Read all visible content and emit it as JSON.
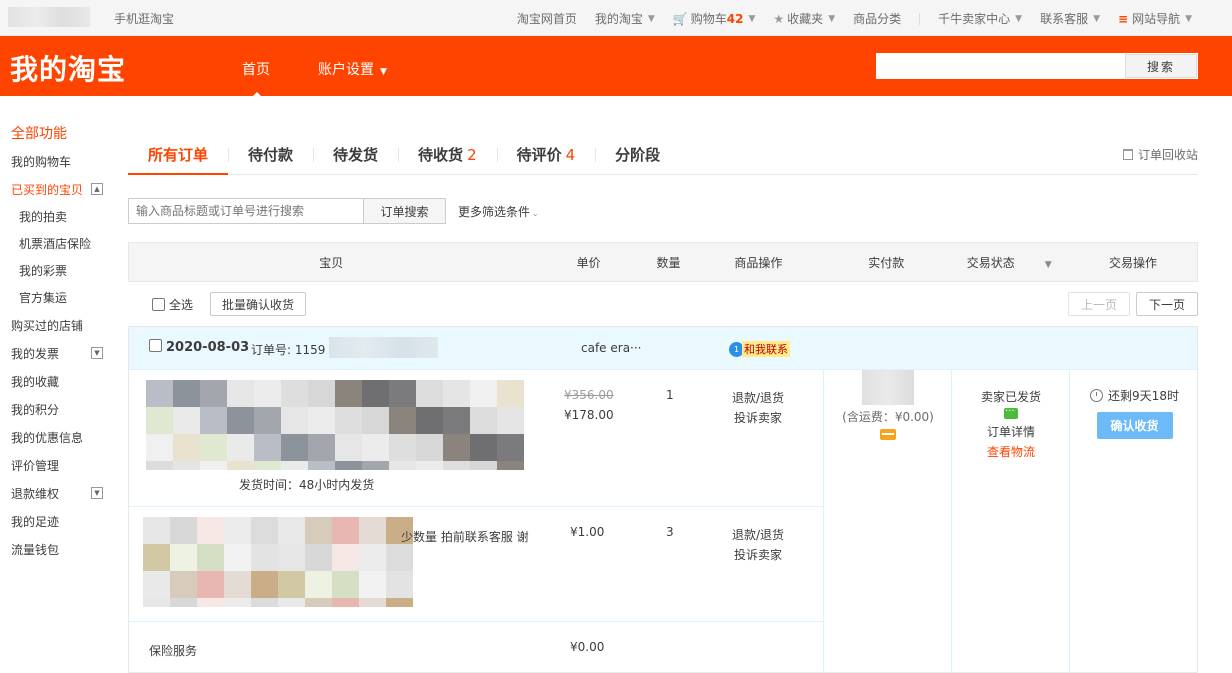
{
  "topbar": {
    "mobile": "手机逛淘宝",
    "links": [
      {
        "label": "淘宝网首页"
      },
      {
        "label": "我的淘宝"
      },
      {
        "label": "购物车",
        "count": "42"
      },
      {
        "label": "收藏夹"
      },
      {
        "label": "商品分类"
      },
      {
        "label": "千牛卖家中心"
      },
      {
        "label": "联系客服"
      },
      {
        "label": "网站导航"
      }
    ]
  },
  "header": {
    "logo": "我的淘宝",
    "nav": [
      {
        "label": "首页"
      },
      {
        "label": "账户设置"
      }
    ],
    "search_button": "搜索",
    "search_value": ""
  },
  "sidebar": {
    "title": "全部功能",
    "items": [
      {
        "label": "我的购物车"
      },
      {
        "label": "已买到的宝贝"
      },
      {
        "label": "我的拍卖"
      },
      {
        "label": "机票酒店保险"
      },
      {
        "label": "我的彩票"
      },
      {
        "label": "官方集运"
      },
      {
        "label": "购买过的店铺"
      },
      {
        "label": "我的发票"
      },
      {
        "label": "我的收藏"
      },
      {
        "label": "我的积分"
      },
      {
        "label": "我的优惠信息"
      },
      {
        "label": "评价管理"
      },
      {
        "label": "退款维权"
      },
      {
        "label": "我的足迹"
      },
      {
        "label": "流量钱包"
      }
    ]
  },
  "tabs": [
    {
      "label": "所有订单",
      "count": ""
    },
    {
      "label": "待付款",
      "count": ""
    },
    {
      "label": "待发货",
      "count": ""
    },
    {
      "label": "待收货",
      "count": "2"
    },
    {
      "label": "待评价",
      "count": "4"
    },
    {
      "label": "分阶段",
      "count": ""
    }
  ],
  "recycle": "订单回收站",
  "filter": {
    "placeholder": "输入商品标题或订单号进行搜索",
    "search_button": "订单搜索",
    "more": "更多筛选条件"
  },
  "table_headers": [
    "宝贝",
    "单价",
    "数量",
    "商品操作",
    "实付款",
    "交易状态",
    "交易操作"
  ],
  "batch": {
    "select_all": "全选",
    "confirm": "批量确认收货",
    "prev": "上一页",
    "next": "下一页"
  },
  "order": {
    "date": "2020-08-03",
    "order_no_label": "订单号: 1159",
    "shop": "cafe era···",
    "contact": "和我联系",
    "items": [
      {
        "ship_time": "发货时间：48小时内发货",
        "orig_price": "¥356.00",
        "price": "¥178.00",
        "qty": "1",
        "ops": [
          "退款/退货",
          "投诉卖家"
        ]
      },
      {
        "title": "少数量 拍前联系客服 谢",
        "price": "¥1.00",
        "qty": "3",
        "ops": [
          "退款/退货",
          "投诉卖家"
        ]
      },
      {
        "title": "保险服务",
        "price": "¥0.00"
      }
    ],
    "shipping_fee": "(含运费：¥0.00)",
    "status": "卖家已发货",
    "detail": "订单详情",
    "track": "查看物流",
    "time_left": "还剩9天18时",
    "confirm": "确认收货"
  }
}
